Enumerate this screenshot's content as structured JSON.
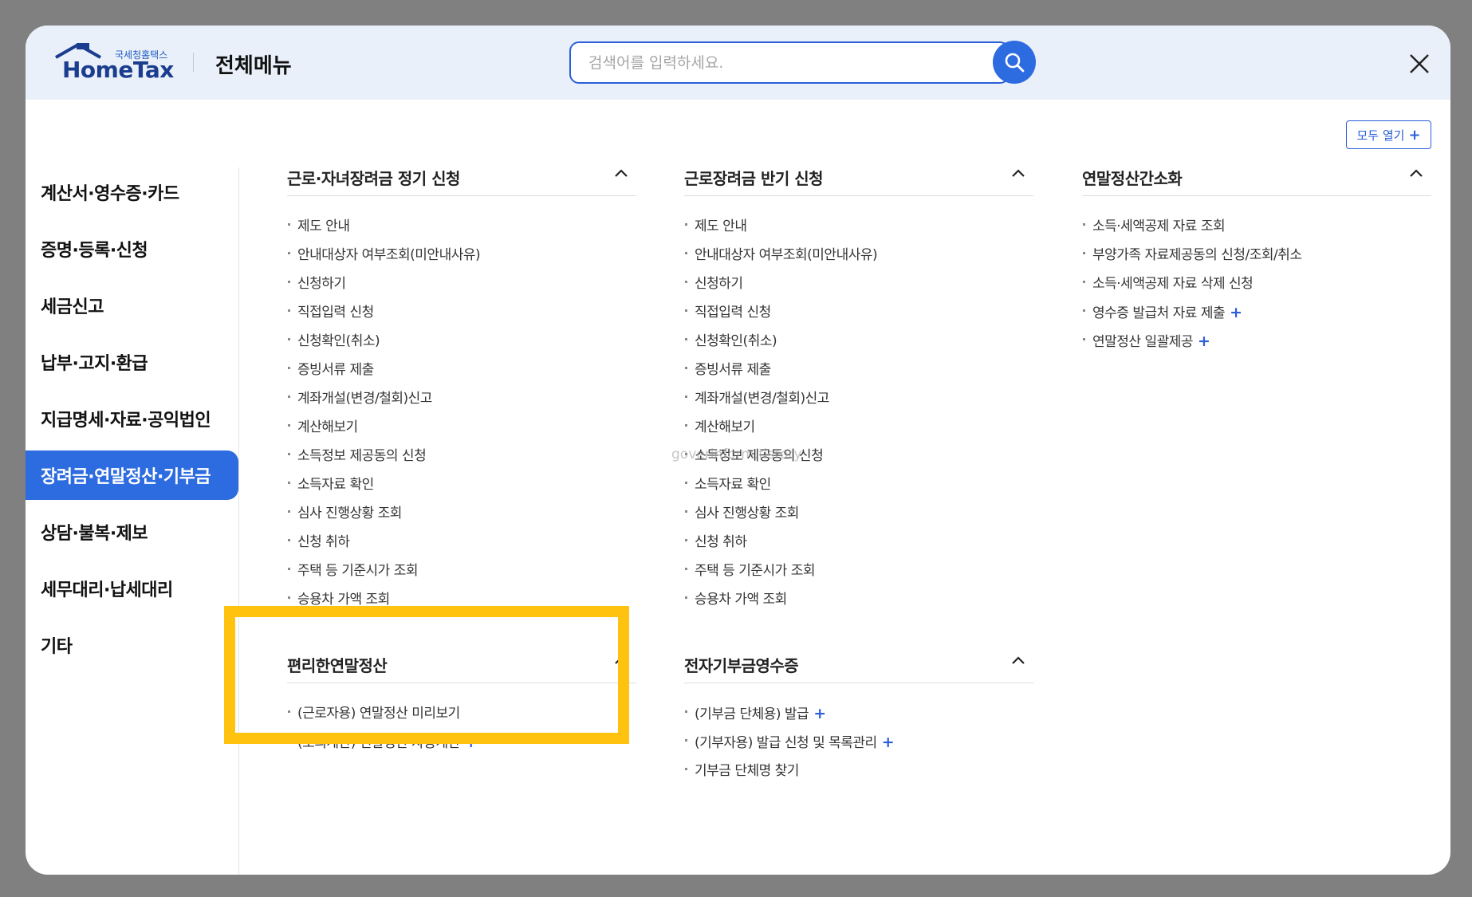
{
  "header": {
    "logo_sub": "국세청홈택스",
    "logo_main": "HomeTax",
    "title": "전체메뉴",
    "search_placeholder": "검색어를 입력하세요.",
    "open_all": "모두 열기"
  },
  "sidebar": {
    "items": [
      {
        "label": "계산서·영수증·카드",
        "active": false
      },
      {
        "label": "증명·등록·신청",
        "active": false
      },
      {
        "label": "세금신고",
        "active": false
      },
      {
        "label": "납부·고지·환급",
        "active": false
      },
      {
        "label": "지급명세·자료·공익법인",
        "active": false
      },
      {
        "label": "장려금·연말정산·기부금",
        "active": true
      },
      {
        "label": "상담·불복·제보",
        "active": false
      },
      {
        "label": "세무대리·납세대리",
        "active": false
      },
      {
        "label": "기타",
        "active": false
      }
    ]
  },
  "sections": {
    "s1": {
      "title": "근로·자녀장려금 정기 신청",
      "items": [
        "제도 안내",
        "안내대상자 여부조회(미안내사유)",
        "신청하기",
        "직접입력 신청",
        "신청확인(취소)",
        "증빙서류 제출",
        "계좌개설(변경/철회)신고",
        "계산해보기",
        "소득정보 제공동의 신청",
        "소득자료 확인",
        "심사 진행상황 조회",
        "신청 취하",
        "주택 등 기준시가 조회",
        "승용차 가액 조회"
      ]
    },
    "s2": {
      "title": "근로장려금 반기 신청",
      "items": [
        "제도 안내",
        "안내대상자 여부조회(미안내사유)",
        "신청하기",
        "직접입력 신청",
        "신청확인(취소)",
        "증빙서류 제출",
        "계좌개설(변경/철회)신고",
        "계산해보기",
        "소득정보 제공동의 신청",
        "소득자료 확인",
        "심사 진행상황 조회",
        "신청 취하",
        "주택 등 기준시가 조회",
        "승용차 가액 조회"
      ]
    },
    "s3": {
      "title": "연말정산간소화",
      "items": [
        "소득·세액공제 자료 조회",
        "부양가족 자료제공동의 신청/조회/취소",
        "소득·세액공제 자료 삭제 신청",
        "영수증 발급처 자료 제출",
        "연말정산 일괄제공"
      ]
    },
    "s4": {
      "title": "편리한연말정산",
      "items": [
        "(근로자용) 연말정산 미리보기",
        "(모의계산) 연말정산 자동계산"
      ]
    },
    "s5": {
      "title": "전자기부금영수증",
      "items": [
        "(기부금 단체용) 발급",
        "(기부자용) 발급 신청 및 목록관리",
        "기부금 단체명 찾기"
      ]
    }
  },
  "expand_symbol": "+",
  "watermark": "goverinform.tistory",
  "colors": {
    "accent": "#2d6be0",
    "header_bg": "#eaf0f9",
    "highlight": "#ffc20e"
  }
}
